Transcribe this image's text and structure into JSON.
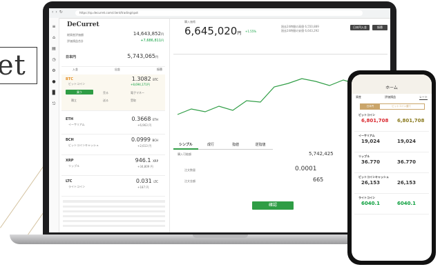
{
  "brand_fragment": "et",
  "browser": {
    "url": "https://sp.decurret.com/client/trading/spot"
  },
  "app": {
    "brand": "DeCurret",
    "total_assets_label": "総資産評価額",
    "total_assets_value": "14,643,852",
    "total_assets_currency": "円",
    "profit_label": "評価損益合計",
    "profit_value": "+7,686,811",
    "profit_currency": "円",
    "jpy_label": "日本円",
    "jpy_value": "5,743,065",
    "jpy_currency": "円",
    "jpy_actions": [
      "入金",
      "出金",
      "振替"
    ],
    "coins": [
      {
        "symbol": "BTC",
        "name": "ビットコイン",
        "amount": "1.3082",
        "unit": "BTC",
        "jpy": "+8,694,171円"
      },
      {
        "symbol": "ETH",
        "name": "イーサリアム",
        "amount": "0.3668",
        "unit": "ETH",
        "jpy": "+6,963 円"
      },
      {
        "symbol": "BCH",
        "name": "ビットコインキャッシュ",
        "amount": "0.0999",
        "unit": "BCH",
        "jpy": "+2,613 円"
      },
      {
        "symbol": "XRP",
        "name": "リップル",
        "amount": "946.1",
        "unit": "XRP",
        "jpy": "+34,809 円"
      },
      {
        "symbol": "LTC",
        "name": "ライトコイン",
        "amount": "0.031",
        "unit": "LTC",
        "jpy": "+187 円"
      }
    ],
    "btc_buttons": [
      "買う",
      "売る",
      "電子マネー",
      "積立",
      "送る",
      "受取"
    ],
    "center": {
      "label": "購入価格",
      "price": "6,645,020",
      "currency": "円",
      "change": "+1.55%",
      "high_label": "過去24時間の高値",
      "high": "6,550,889",
      "low_label": "過去24時間の安値",
      "low": "6,643,292",
      "buttons": [
        "日本円入金",
        "振替"
      ],
      "chart_tabs": [
        "1分",
        "5分",
        "15分",
        "1時間",
        "4時間",
        "1日"
      ],
      "order_tabs": [
        "シンプル",
        "成行",
        "指値",
        "逆指値"
      ],
      "buy_label": "購入可能額",
      "buy_value": "5,742,425",
      "qty_label": "注文数量",
      "qty_value": "0.0001",
      "amount_label": "注文金額",
      "amount_value": "665",
      "confirm_label": "確認"
    }
  },
  "phone": {
    "title": "ホーム",
    "tabs": [
      "資産",
      "評価損益",
      "レート"
    ],
    "filter": [
      "日本円",
      "ビットコイン建て"
    ],
    "coins": [
      {
        "name": "ビットコイン",
        "v1": "6,801,708",
        "v2": "6,801,708"
      },
      {
        "name": "イーサリアム",
        "v1": "19,024",
        "v2": "19,024"
      },
      {
        "name": "リップル",
        "v1": "36.770",
        "v2": "36.770"
      },
      {
        "name": "ビットコインキャッシュ",
        "v1": "26,153",
        "v2": "26,153"
      },
      {
        "name": "ライトコイン",
        "v1": "6040.1",
        "v2": "6040.1"
      }
    ]
  }
}
